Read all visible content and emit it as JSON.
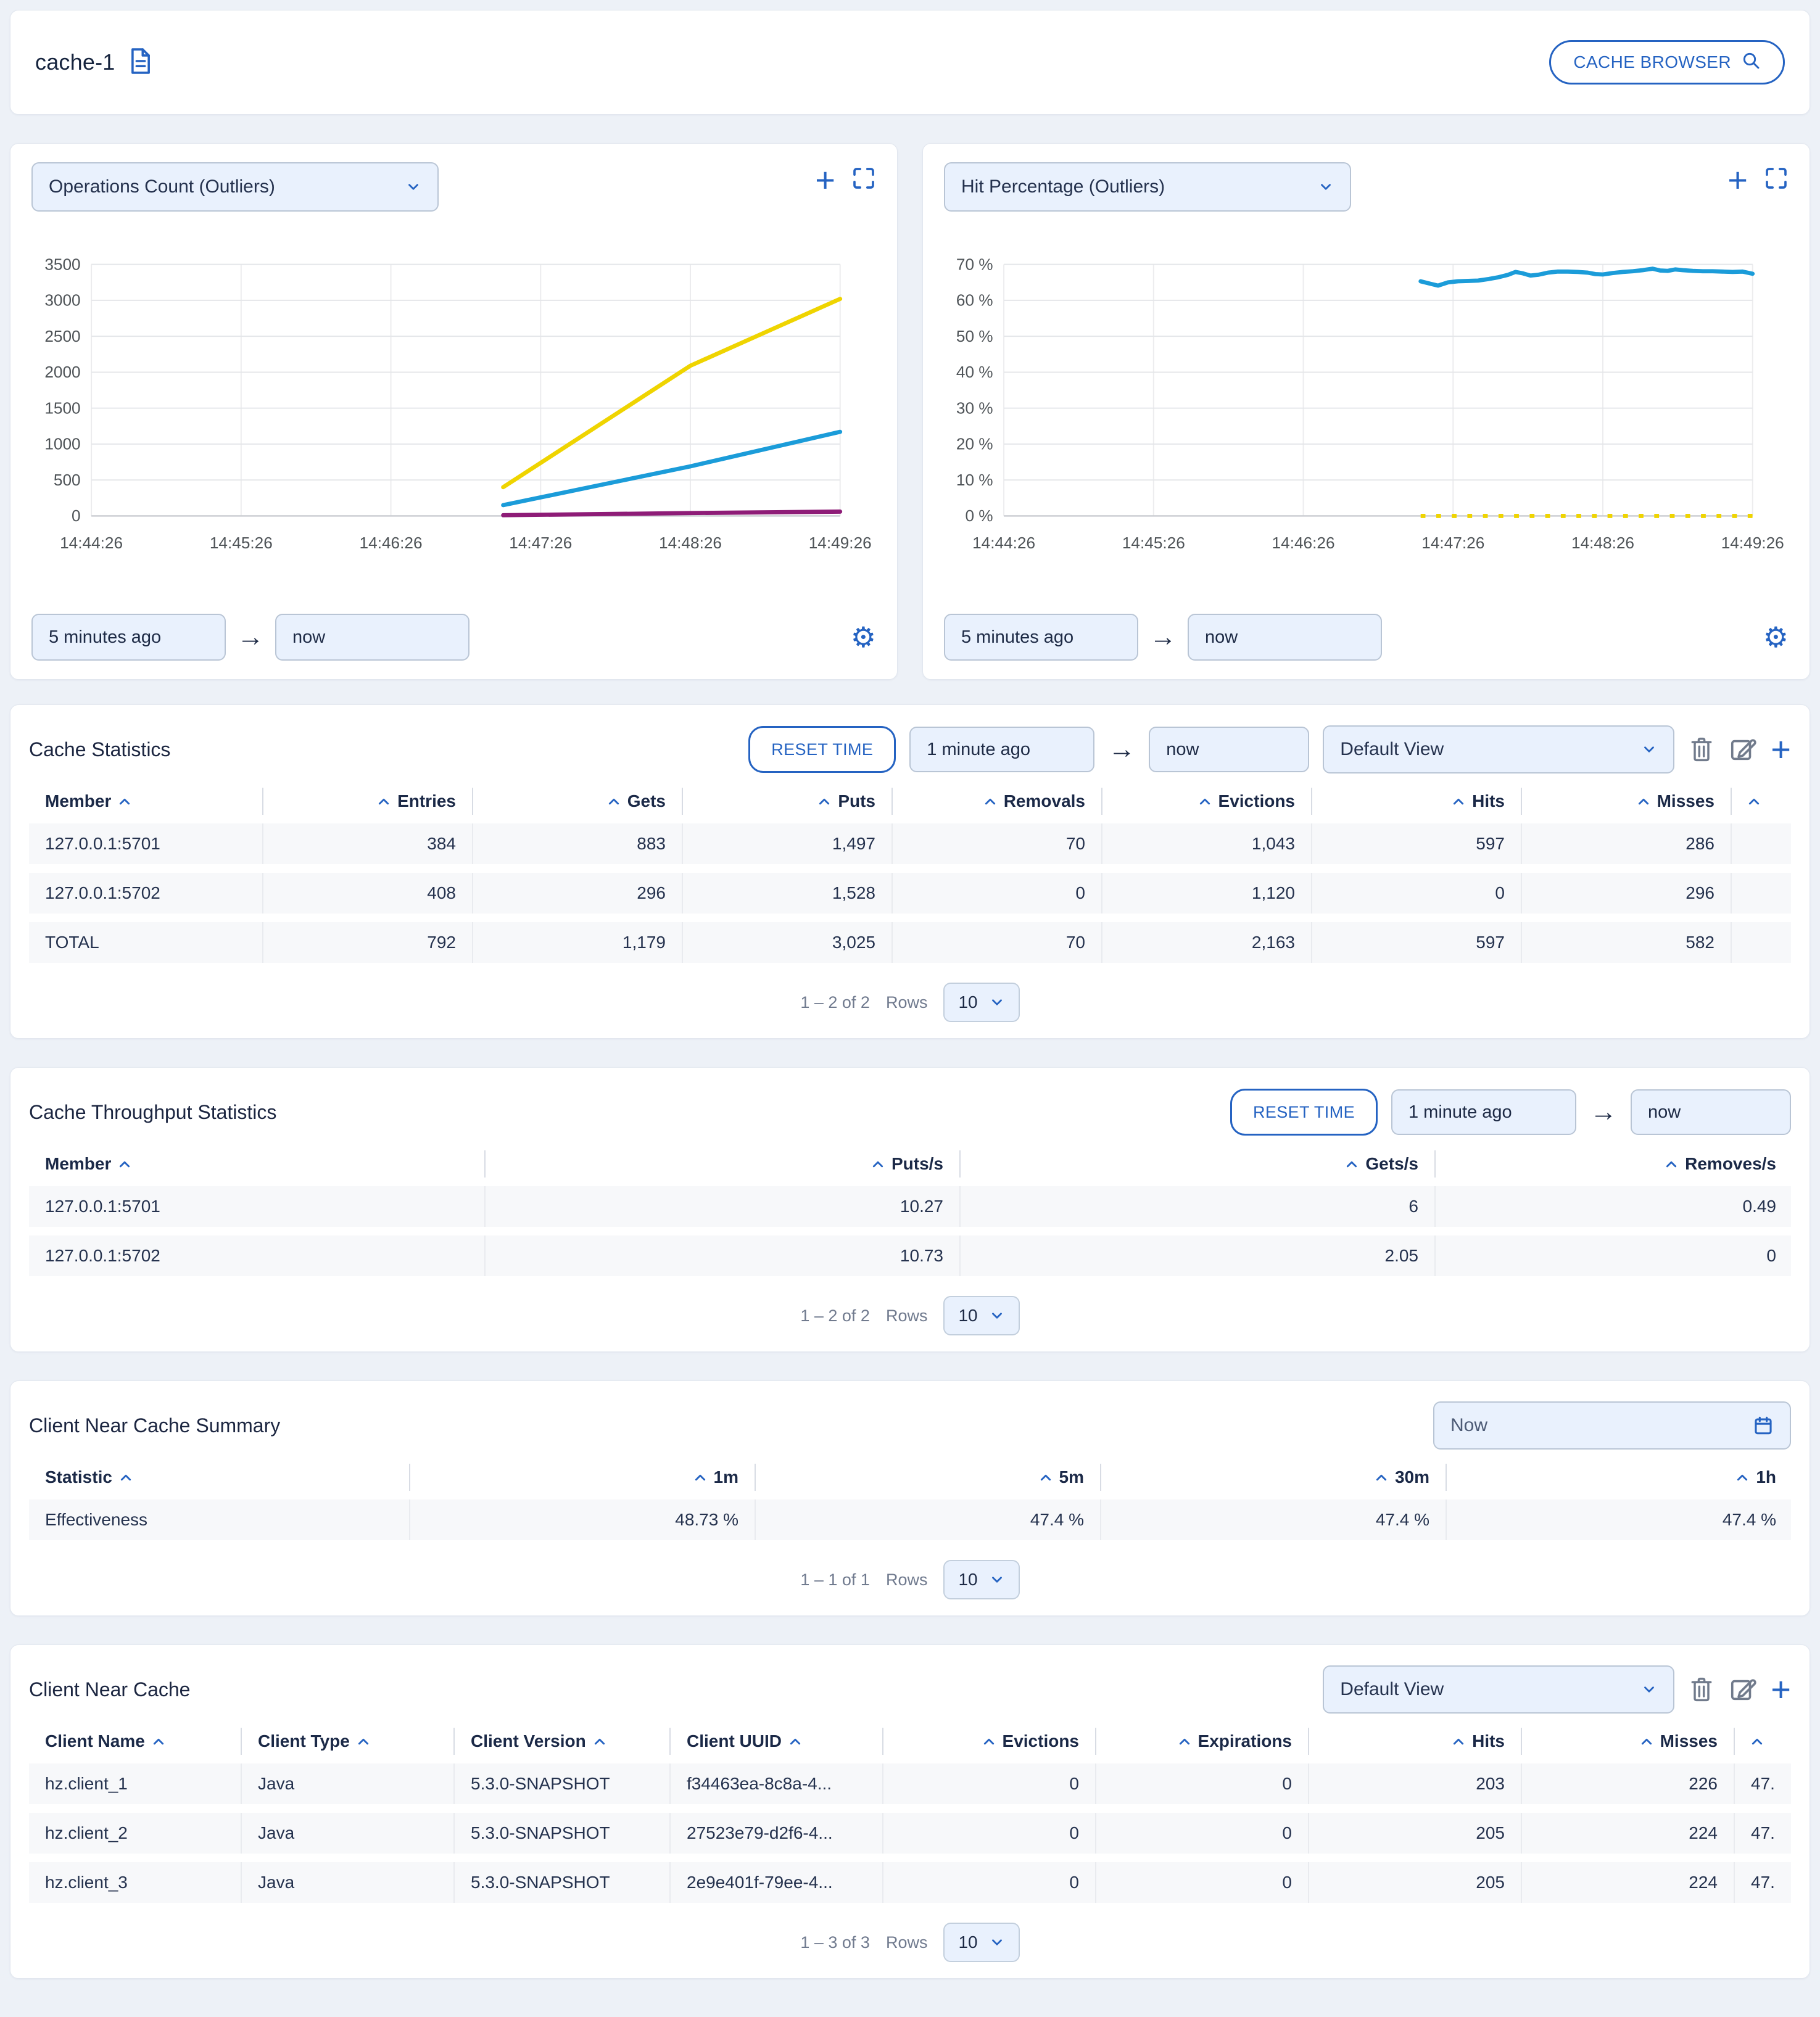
{
  "page": {
    "background": "#edf1f7",
    "accent_blue": "#2563c2"
  },
  "header": {
    "title": "cache-1",
    "browser_button": "CACHE BROWSER"
  },
  "charts": [
    {
      "selector": "Operations Count (Outliers)",
      "from": "5 minutes ago",
      "to": "now"
    },
    {
      "selector": "Hit Percentage (Outliers)",
      "from": "5 minutes ago",
      "to": "now"
    }
  ],
  "chart_data": [
    {
      "type": "line",
      "title": "Operations Count (Outliers)",
      "x_ticks": [
        "14:44:26",
        "14:45:26",
        "14:46:26",
        "14:47:26",
        "14:48:26",
        "14:49:26"
      ],
      "x_range_seconds": [
        0,
        300
      ],
      "ylim": [
        0,
        3500
      ],
      "y_ticks": [
        0,
        500,
        1000,
        1500,
        2000,
        2500,
        3000,
        3500
      ],
      "y_suffix": "",
      "grid": true,
      "legend": "none",
      "series": [
        {
          "name": "puts",
          "color": "#efd400",
          "points": [
            [
              165,
              400
            ],
            [
              240,
              2090
            ],
            [
              300,
              3020
            ]
          ]
        },
        {
          "name": "gets",
          "color": "#1b9cd9",
          "points": [
            [
              165,
              150
            ],
            [
              240,
              690
            ],
            [
              300,
              1170
            ]
          ]
        },
        {
          "name": "removals",
          "color": "#8e1c77",
          "points": [
            [
              165,
              10
            ],
            [
              240,
              40
            ],
            [
              300,
              60
            ]
          ]
        }
      ]
    },
    {
      "type": "line",
      "title": "Hit Percentage (Outliers)",
      "x_ticks": [
        "14:44:26",
        "14:45:26",
        "14:46:26",
        "14:47:26",
        "14:48:26",
        "14:49:26"
      ],
      "x_range_seconds": [
        0,
        300
      ],
      "ylim": [
        0,
        70
      ],
      "y_ticks": [
        0,
        10,
        20,
        30,
        40,
        50,
        60,
        70
      ],
      "y_suffix": " %",
      "grid": true,
      "legend": "none",
      "series": [
        {
          "name": "hit-percentage",
          "color": "#1b9cd9",
          "points": [
            [
              167,
              65.3
            ],
            [
              171,
              64.6
            ],
            [
              174,
              64.1
            ],
            [
              178,
              65.0
            ],
            [
              182,
              65.3
            ],
            [
              186,
              65.4
            ],
            [
              190,
              65.5
            ],
            [
              194,
              65.9
            ],
            [
              198,
              66.4
            ],
            [
              202,
              67.1
            ],
            [
              205,
              67.9
            ],
            [
              208,
              67.5
            ],
            [
              211,
              66.9
            ],
            [
              214,
              67.1
            ],
            [
              218,
              67.7
            ],
            [
              222,
              68.0
            ],
            [
              226,
              68.0
            ],
            [
              230,
              67.9
            ],
            [
              234,
              67.7
            ],
            [
              237,
              67.3
            ],
            [
              240,
              67.2
            ],
            [
              244,
              67.6
            ],
            [
              248,
              67.9
            ],
            [
              252,
              68.1
            ],
            [
              256,
              68.4
            ],
            [
              260,
              68.8
            ],
            [
              263,
              68.3
            ],
            [
              266,
              68.2
            ],
            [
              269,
              68.6
            ],
            [
              272,
              68.4
            ],
            [
              276,
              68.2
            ],
            [
              280,
              68.1
            ],
            [
              284,
              68.1
            ],
            [
              288,
              68.0
            ],
            [
              292,
              67.9
            ],
            [
              296,
              68.0
            ],
            [
              300,
              67.4
            ]
          ]
        },
        {
          "name": "zero-baseline",
          "color": "#efd400",
          "dash": "8 18",
          "points": [
            [
              167,
              0
            ],
            [
              300,
              0
            ]
          ]
        }
      ]
    }
  ],
  "cache_statistics": {
    "title": "Cache Statistics",
    "reset_button": "RESET TIME",
    "from": "1 minute ago",
    "to": "now",
    "view_select": "Default View",
    "table": {
      "columns": [
        {
          "label": "Member",
          "num": false
        },
        {
          "label": "Entries",
          "num": true
        },
        {
          "label": "Gets",
          "num": true
        },
        {
          "label": "Puts",
          "num": true
        },
        {
          "label": "Removals",
          "num": true
        },
        {
          "label": "Evictions",
          "num": true
        },
        {
          "label": "Hits",
          "num": true
        },
        {
          "label": "Misses",
          "num": true
        },
        {
          "label": "",
          "num": false
        }
      ],
      "widths": [
        380,
        340,
        340,
        340,
        340,
        340,
        340,
        340,
        120
      ],
      "rows": [
        [
          "127.0.0.1:5701",
          "384",
          "883",
          "1,497",
          "70",
          "1,043",
          "597",
          "286",
          ""
        ],
        [
          "127.0.0.1:5702",
          "408",
          "296",
          "1,528",
          "0",
          "1,120",
          "0",
          "296",
          ""
        ],
        [
          "TOTAL",
          "792",
          "1,179",
          "3,025",
          "70",
          "2,163",
          "597",
          "582",
          ""
        ]
      ]
    },
    "pagination": {
      "range": "1 – 2 of 2",
      "rows_label": "Rows",
      "rows_value": "10"
    }
  },
  "cache_throughput": {
    "title": "Cache Throughput Statistics",
    "reset_button": "RESET TIME",
    "from": "1 minute ago",
    "to": "now",
    "table": {
      "columns": [
        {
          "label": "Member",
          "num": false
        },
        {
          "label": "Puts/s",
          "num": true
        },
        {
          "label": "Gets/s",
          "num": true
        },
        {
          "label": "Removes/s",
          "num": true
        }
      ],
      "widths": [
        740,
        770,
        770,
        578
      ],
      "rows": [
        [
          "127.0.0.1:5701",
          "10.27",
          "6",
          "0.49"
        ],
        [
          "127.0.0.1:5702",
          "10.73",
          "2.05",
          "0"
        ]
      ]
    },
    "pagination": {
      "range": "1 – 2 of 2",
      "rows_label": "Rows",
      "rows_value": "10"
    }
  },
  "near_cache_summary": {
    "title": "Client Near Cache Summary",
    "time_value": "Now",
    "table": {
      "columns": [
        {
          "label": "Statistic",
          "num": false
        },
        {
          "label": "1m",
          "num": true
        },
        {
          "label": "5m",
          "num": true
        },
        {
          "label": "30m",
          "num": true
        },
        {
          "label": "1h",
          "num": true
        }
      ],
      "widths": [
        618,
        560,
        560,
        560,
        560
      ],
      "rows": [
        [
          "Effectiveness",
          "48.73 %",
          "47.4 %",
          "47.4 %",
          "47.4 %"
        ]
      ]
    },
    "pagination": {
      "range": "1 – 1 of 1",
      "rows_label": "Rows",
      "rows_value": "10"
    }
  },
  "near_cache": {
    "title": "Client Near Cache",
    "view_select": "Default View",
    "table": {
      "columns": [
        {
          "label": "Client Name",
          "num": false
        },
        {
          "label": "Client Type",
          "num": false
        },
        {
          "label": "Client Version",
          "num": false
        },
        {
          "label": "Client UUID",
          "num": false
        },
        {
          "label": "Evictions",
          "num": true
        },
        {
          "label": "Expirations",
          "num": true
        },
        {
          "label": "Hits",
          "num": true
        },
        {
          "label": "Misses",
          "num": true
        },
        {
          "label": "",
          "num": false
        }
      ],
      "widths": [
        345,
        345,
        350,
        345,
        345,
        345,
        345,
        345,
        160
      ],
      "rows": [
        [
          "hz.client_1",
          "Java",
          "5.3.0-SNAPSHOT",
          "f34463ea-8c8a-4...",
          "0",
          "0",
          "203",
          "226",
          "47."
        ],
        [
          "hz.client_2",
          "Java",
          "5.3.0-SNAPSHOT",
          "27523e79-d2f6-4...",
          "0",
          "0",
          "205",
          "224",
          "47."
        ],
        [
          "hz.client_3",
          "Java",
          "5.3.0-SNAPSHOT",
          "2e9e401f-79ee-4...",
          "0",
          "0",
          "205",
          "224",
          "47."
        ]
      ]
    },
    "pagination": {
      "range": "1 – 3 of 3",
      "rows_label": "Rows",
      "rows_value": "10"
    }
  }
}
